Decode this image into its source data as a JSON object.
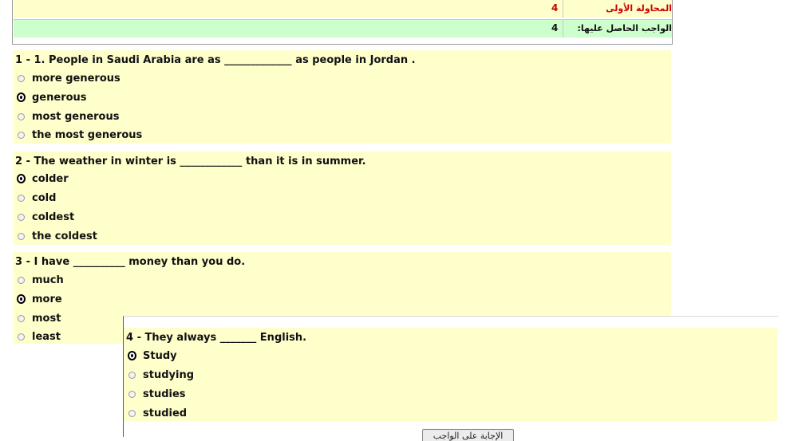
{
  "results": {
    "row1": {
      "label": "المحاولة الأولى",
      "value": "4"
    },
    "row2": {
      "label": "الواجب الحاصل عليها:",
      "value": "4"
    }
  },
  "questions": [
    {
      "title": "1 - 1. People in Saudi Arabia are as _____________ as people in Jordan .",
      "options": [
        "more generous",
        "generous",
        "most generous",
        "the most generous"
      ],
      "selected_index": 1
    },
    {
      "title": "2 - The weather in winter is ____________ than it is in summer.",
      "options": [
        "colder",
        "cold",
        "coldest",
        "the coldest"
      ],
      "selected_index": 0
    },
    {
      "title": "3 - I have __________ money than you do.",
      "options": [
        "much",
        "more",
        "most",
        "least"
      ],
      "selected_index": 1
    },
    {
      "title": "4 - They always _______ English.",
      "options": [
        "Study",
        "studying",
        "studies",
        "studied"
      ],
      "selected_index": 0
    }
  ],
  "submit_button": {
    "label": "الإجابة على الواجب"
  },
  "colors": {
    "question_bg": "#ffffcc",
    "result_bg_green": "#ccffcc",
    "attempt_red": "#cc0000"
  }
}
